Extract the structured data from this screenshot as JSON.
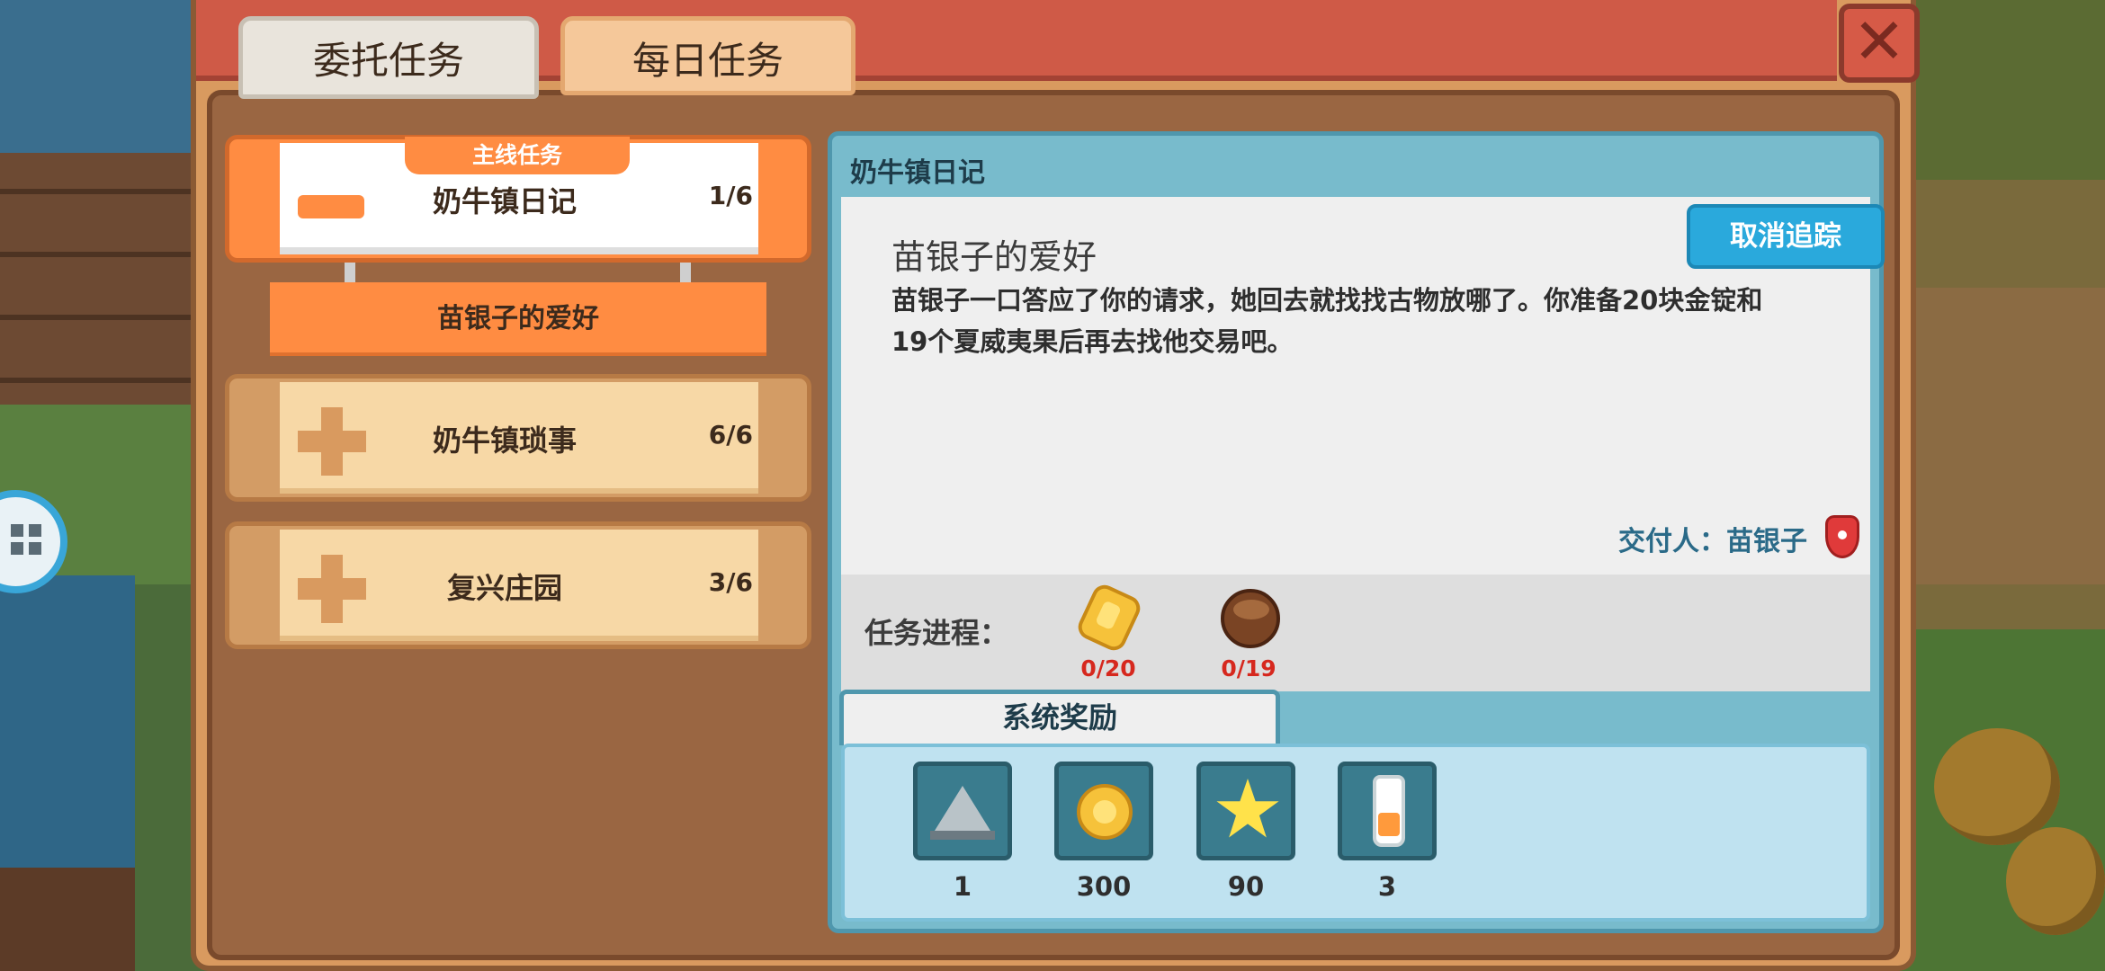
{
  "tabs": {
    "commission": "委托任务",
    "daily": "每日任务"
  },
  "close_icon": "close-x-icon",
  "quest_list": {
    "main_badge": "主线任务",
    "groups": [
      {
        "title": "奶牛镇日记",
        "count": "1/6",
        "expanded": true
      },
      {
        "title": "奶牛镇琐事",
        "count": "6/6",
        "expanded": false
      },
      {
        "title": "复兴庄园",
        "count": "3/6",
        "expanded": false
      }
    ],
    "active_subquest": "苗银子的爱好"
  },
  "detail": {
    "header": "奶牛镇日记",
    "subtitle": "苗银子的爱好",
    "description": "苗银子一口答应了你的请求，她回去就找找古物放哪了。你准备20块金锭和19个夏威夷果后再去找他交易吧。",
    "untrack_label": "取消追踪",
    "deliver_label": "交付人：苗银子",
    "progress_label": "任务进程：",
    "progress_items": [
      {
        "icon": "gold-ingot-icon",
        "count": "0/20"
      },
      {
        "icon": "macadamia-nut-icon",
        "count": "0/19"
      }
    ],
    "reward_tab": "系统奖励",
    "rewards": [
      {
        "icon": "wedge-item-icon",
        "count": "1"
      },
      {
        "icon": "gold-coin-icon",
        "count": "300"
      },
      {
        "icon": "star-icon",
        "count": "90"
      },
      {
        "icon": "milk-bottle-icon",
        "count": "3"
      }
    ]
  },
  "colors": {
    "accent_orange": "#ff8c42",
    "title_bar_red": "#cf5a47",
    "detail_blue": "#78bbcc",
    "button_blue": "#2aa9dc",
    "progress_red": "#d6281e"
  }
}
